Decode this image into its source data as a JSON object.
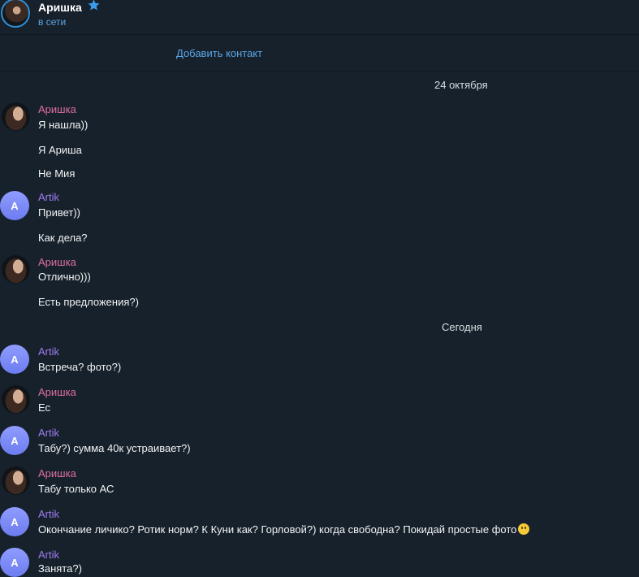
{
  "header": {
    "name": "Аришка",
    "status": "в сети"
  },
  "add_contact": "Добавить контакт",
  "dates": [
    "24 октября",
    "Сегодня"
  ],
  "messages": [
    {
      "sender": "Аришка",
      "lines": [
        "Я нашла))",
        "Я Ариша",
        "Не Мия"
      ]
    },
    {
      "sender": "Artik",
      "avatar_letter": "A",
      "lines": [
        "Привет))",
        "Как дела?"
      ]
    },
    {
      "sender": "Аришка",
      "lines": [
        "Отлично)))",
        "Есть предложения?)"
      ]
    },
    {
      "sender": "Artik",
      "avatar_letter": "A",
      "lines": [
        "Встреча? фото?)"
      ]
    },
    {
      "sender": "Аришка",
      "lines": [
        "Ес"
      ]
    },
    {
      "sender": "Artik",
      "avatar_letter": "A",
      "lines": [
        "Табу?) сумма 40к устраивает?)"
      ]
    },
    {
      "sender": "Аришка",
      "lines": [
        "Табу только АС"
      ]
    },
    {
      "sender": "Artik",
      "avatar_letter": "A",
      "lines": [
        "Окончание личико? Ротик норм? К Куни как? Горловой?) когда свободна? Покидай простые фото"
      ]
    },
    {
      "sender": "Artik",
      "avatar_letter": "A",
      "lines": [
        "Занята?)"
      ]
    }
  ],
  "colors": {
    "background": "#17212b",
    "link": "#5aa7e8",
    "arishka_name": "#dd6fa2",
    "artik_name": "#9d7cf0"
  }
}
